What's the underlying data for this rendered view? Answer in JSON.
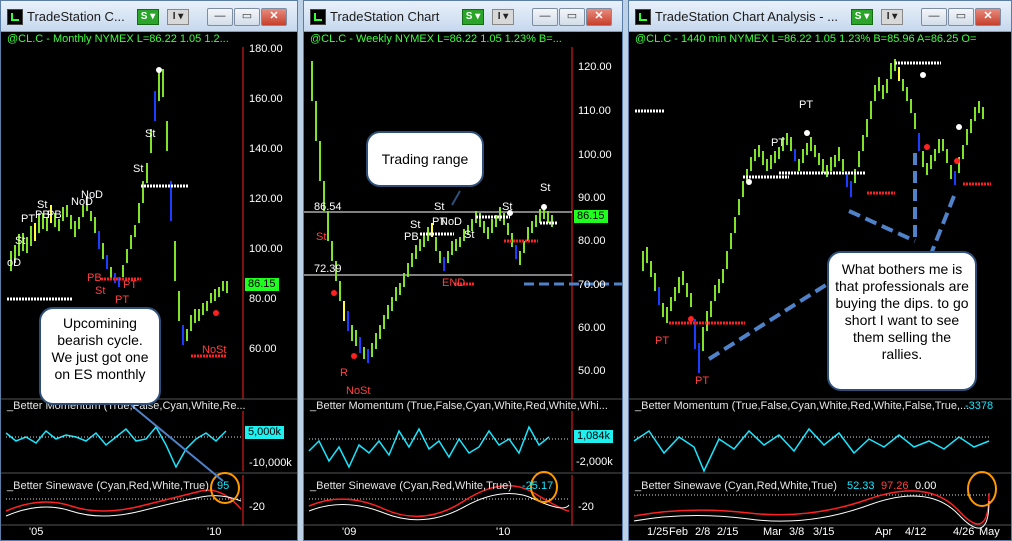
{
  "windows": [
    {
      "title": "TradeStation C...",
      "header": "@CL.C - Monthly  NYMEX  L=86.22  1.05  1.2...",
      "price_axis": [
        "180.00",
        "160.00",
        "140.00",
        "120.00",
        "100.00",
        "80.00",
        "60.00"
      ],
      "last_price": "86.15",
      "momentum_label": "_Better Momentum (True,False,Cyan,White,Re...",
      "momentum_axis_box": "5,000k",
      "momentum_axis": [
        "-10,000k"
      ],
      "sinewave_label": "_Better Sinewave (Cyan,Red,White,True)",
      "sinewave_value": "95",
      "sine_axis": [
        "-20"
      ],
      "dates": [
        "'05",
        "'10"
      ],
      "markers": [
        "St",
        "St",
        "PT",
        "PB",
        "PB",
        "NoD",
        "NoD",
        "St",
        "St",
        "PB",
        "PT",
        "St",
        "PT",
        "NoSt",
        "NoD",
        "PT",
        "PT"
      ]
    },
    {
      "title": "TradeStation Chart",
      "header": "@CL.C - Weekly  NYMEX  L=86.22  1.05  1.23%  B=...",
      "price_axis": [
        "120.00",
        "110.00",
        "100.00",
        "90.00",
        "80.00",
        "70.00",
        "60.00",
        "50.00"
      ],
      "last_price": "86.15",
      "range_high": "86.54",
      "range_low": "72.39",
      "momentum_label": "_Better Momentum (True,False,Cyan,White,Red,White,Whi...",
      "momentum_axis_box": "1,084k",
      "momentum_axis": [
        "-2,000k"
      ],
      "sinewave_label": "_Better Sinewave (Cyan,Red,White,True)",
      "sinewave_value": "-25.17",
      "sine_axis": [
        "-20"
      ],
      "dates": [
        "'09",
        "'10"
      ],
      "markers": [
        "St",
        "St",
        "PB",
        "PT",
        "NoD",
        "St",
        "St",
        "St",
        "St",
        "R",
        "NoSt",
        "END"
      ]
    },
    {
      "title": "TradeStation Chart Analysis - ...",
      "header": "@CL.C - 1440 min  NYMEX  L=86.22  1.05  1.23%  B=85.96  A=86.25  O=",
      "momentum_label": "_Better Momentum (True,False,Cyan,White,Red,White,False,True,...",
      "momentum_value": "-3378",
      "sinewave_label": "_Better Sinewave (Cyan,Red,White,True)",
      "sinewave_values": [
        "52.33",
        "97.26",
        "0.00"
      ],
      "dates": [
        "1/25",
        "Feb",
        "2/8",
        "2/15",
        "Mar",
        "3/8",
        "3/15",
        "Apr",
        "4/12",
        "4/26",
        "May"
      ],
      "markers": [
        "PT",
        "PT",
        "PT",
        "PT"
      ]
    }
  ],
  "callouts": {
    "trading_range": "Trading range",
    "upcoming": "Upcomining bearish cycle. We just got one on ES monthly",
    "bothers": "What bothers me is that professionals are buying the dips. to go short I want to see them selling the rallies."
  },
  "colors": {
    "up_bar": "#7fe32a",
    "down_bar": "#1a3dff",
    "neutral_bar": "#ffff33",
    "marker_red": "#ff2020",
    "marker_white": "#ffffff",
    "cyan": "#19e6ff",
    "callout_border": "#2d4f7a",
    "arrow": "#4f82c9",
    "ellipse": "#ff9900"
  }
}
